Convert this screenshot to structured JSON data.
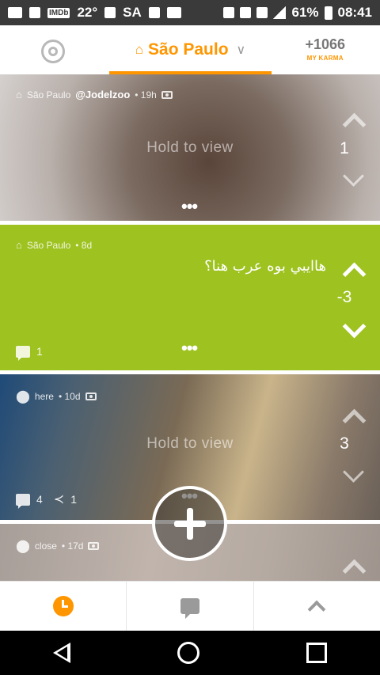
{
  "statusbar": {
    "temperature": "22°",
    "carrier": "SA",
    "battery": "61%",
    "time": "08:41",
    "imdb": "IMDb"
  },
  "header": {
    "location": "São Paulo",
    "karma_value": "+1066",
    "karma_label": "MY KARMA"
  },
  "posts": [
    {
      "location": "São Paulo",
      "handle": "@Jodelzoo",
      "age": "• 19h",
      "hold_text": "Hold to view",
      "votes": "1",
      "dots": "•••"
    },
    {
      "location": "São Paulo",
      "age": "• 8d",
      "text": "هاايبي بوه عرب هنا؟",
      "votes": "-3",
      "comments": "1",
      "dots": "•••",
      "color": "#9ec220"
    },
    {
      "location": "here",
      "age": "• 10d",
      "hold_text": "Hold to view",
      "votes": "3",
      "comments": "4",
      "shares": "1",
      "dots": "•••"
    },
    {
      "location": "close",
      "age": "• 17d"
    }
  ],
  "theme": {
    "accent": "#ff9600",
    "post_green": "#9ec220"
  }
}
